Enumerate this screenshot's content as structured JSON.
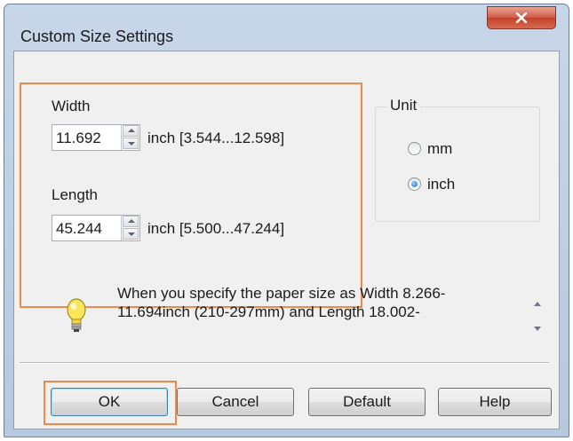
{
  "window": {
    "title": "Custom Size Settings"
  },
  "size": {
    "width_label": "Width",
    "width_value": "11.692",
    "width_range": "inch [3.544...12.598]",
    "length_label": "Length",
    "length_value": "45.244",
    "length_range": "inch [5.500...47.244]"
  },
  "unit": {
    "legend": "Unit",
    "options": [
      "mm",
      "inch"
    ],
    "selected": "inch"
  },
  "info": {
    "line1": "When you specify the paper size as Width 8.266-",
    "line2": "11.694inch (210-297mm) and Length 18.002-"
  },
  "buttons": {
    "ok": "OK",
    "cancel": "Cancel",
    "default": "Default",
    "help": "Help"
  },
  "colors": {
    "highlight": "#f08a4b",
    "close": "#c2412b"
  }
}
